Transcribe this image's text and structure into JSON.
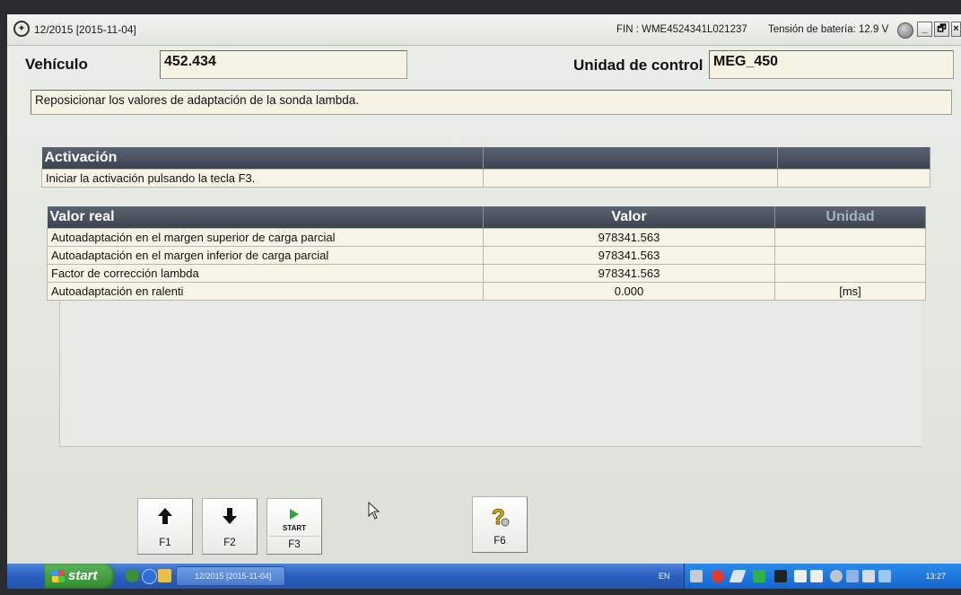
{
  "window": {
    "title": "12/2015 [2015-11-04]",
    "fin": "FIN : WME4524341L021237",
    "battery": "Tensión de batería: 12.9 V",
    "min_label": "_",
    "restore_label": "🗗",
    "close_label": "×"
  },
  "vehicle": {
    "label": "Vehículo",
    "value": "452.434"
  },
  "control_unit": {
    "label": "Unidad de control",
    "value": "MEG_450"
  },
  "description": "Reposicionar los valores de adaptación de la sonda lambda.",
  "activation_table": {
    "header": "Activación",
    "row": "Iniciar la activación pulsando la tecla F3."
  },
  "values_table": {
    "headers": [
      "Valor real",
      "Valor",
      "Unidad"
    ],
    "rows": [
      [
        "Autoadaptación en el margen superior de carga parcial",
        "978341.563",
        ""
      ],
      [
        "Autoadaptación en el margen inferior de carga parcial",
        "978341.563",
        ""
      ],
      [
        "Factor de corrección lambda",
        "978341.563",
        ""
      ],
      [
        "Autoadaptación en ralenti",
        "0.000",
        "[ms]"
      ]
    ]
  },
  "function_keys": [
    {
      "label": "F1",
      "icon": "arrow-up-icon"
    },
    {
      "label": "F2",
      "icon": "arrow-down-icon"
    },
    {
      "label": "F3",
      "icon": "start-play-icon",
      "sub": "START"
    },
    {
      "label": "F6",
      "icon": "help-icon"
    }
  ],
  "taskbar": {
    "start": "start",
    "task": "12/2015 [2015-11-04]",
    "lang": "EN",
    "clock": "13:27"
  },
  "colors": {
    "header_bg": "#3d4350",
    "field_bg": "#f6f3e4",
    "taskbar_blue": "#2a5fc0",
    "start_green": "#2f8d2f"
  }
}
